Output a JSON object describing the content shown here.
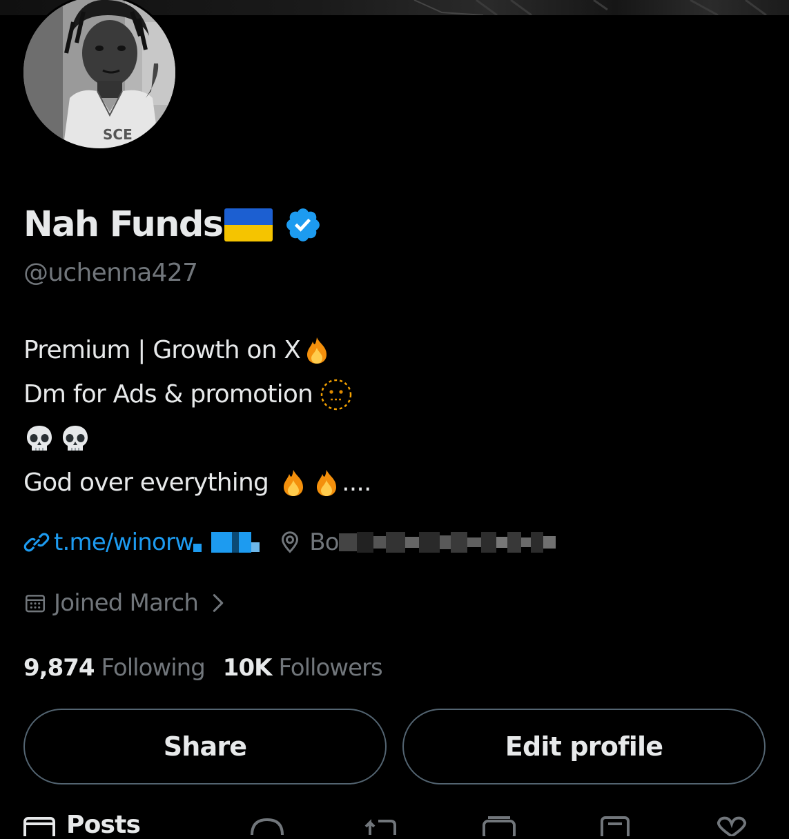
{
  "profile": {
    "display_name": "Nah Funds",
    "flag_emoji": "ukraine-flag",
    "verified": true,
    "handle": "@uchenna427",
    "bio": {
      "line1": "Premium | Growth on X",
      "line2": "Dm for Ads & promotion",
      "line4": "God over everything",
      "line4_suffix": "...."
    },
    "link": {
      "text": "t.me/winorw"
    },
    "location": {
      "text": "Bo"
    },
    "joined": "Joined March",
    "following_count": "9,874",
    "following_label": "Following",
    "followers_count": "10K",
    "followers_label": "Followers"
  },
  "buttons": {
    "share": "Share",
    "edit_profile": "Edit profile"
  },
  "tabs": {
    "posts": "Posts"
  },
  "colors": {
    "background": "#000000",
    "text_primary": "#e7e9ea",
    "text_secondary": "#71767b",
    "accent": "#1d9bf0",
    "button_border": "#536471",
    "verified_badge": "#1d9bf0",
    "flag_blue": "#1c5fd1",
    "flag_yellow": "#f5c400"
  },
  "icons": {
    "verified": "verified-badge-icon",
    "link": "link-icon",
    "location": "location-pin-icon",
    "calendar": "calendar-icon",
    "chevron": "chevron-right-icon",
    "fire": "fire-emoji",
    "dotted_face": "dotted-line-face-emoji",
    "skull": "skull-emoji"
  }
}
